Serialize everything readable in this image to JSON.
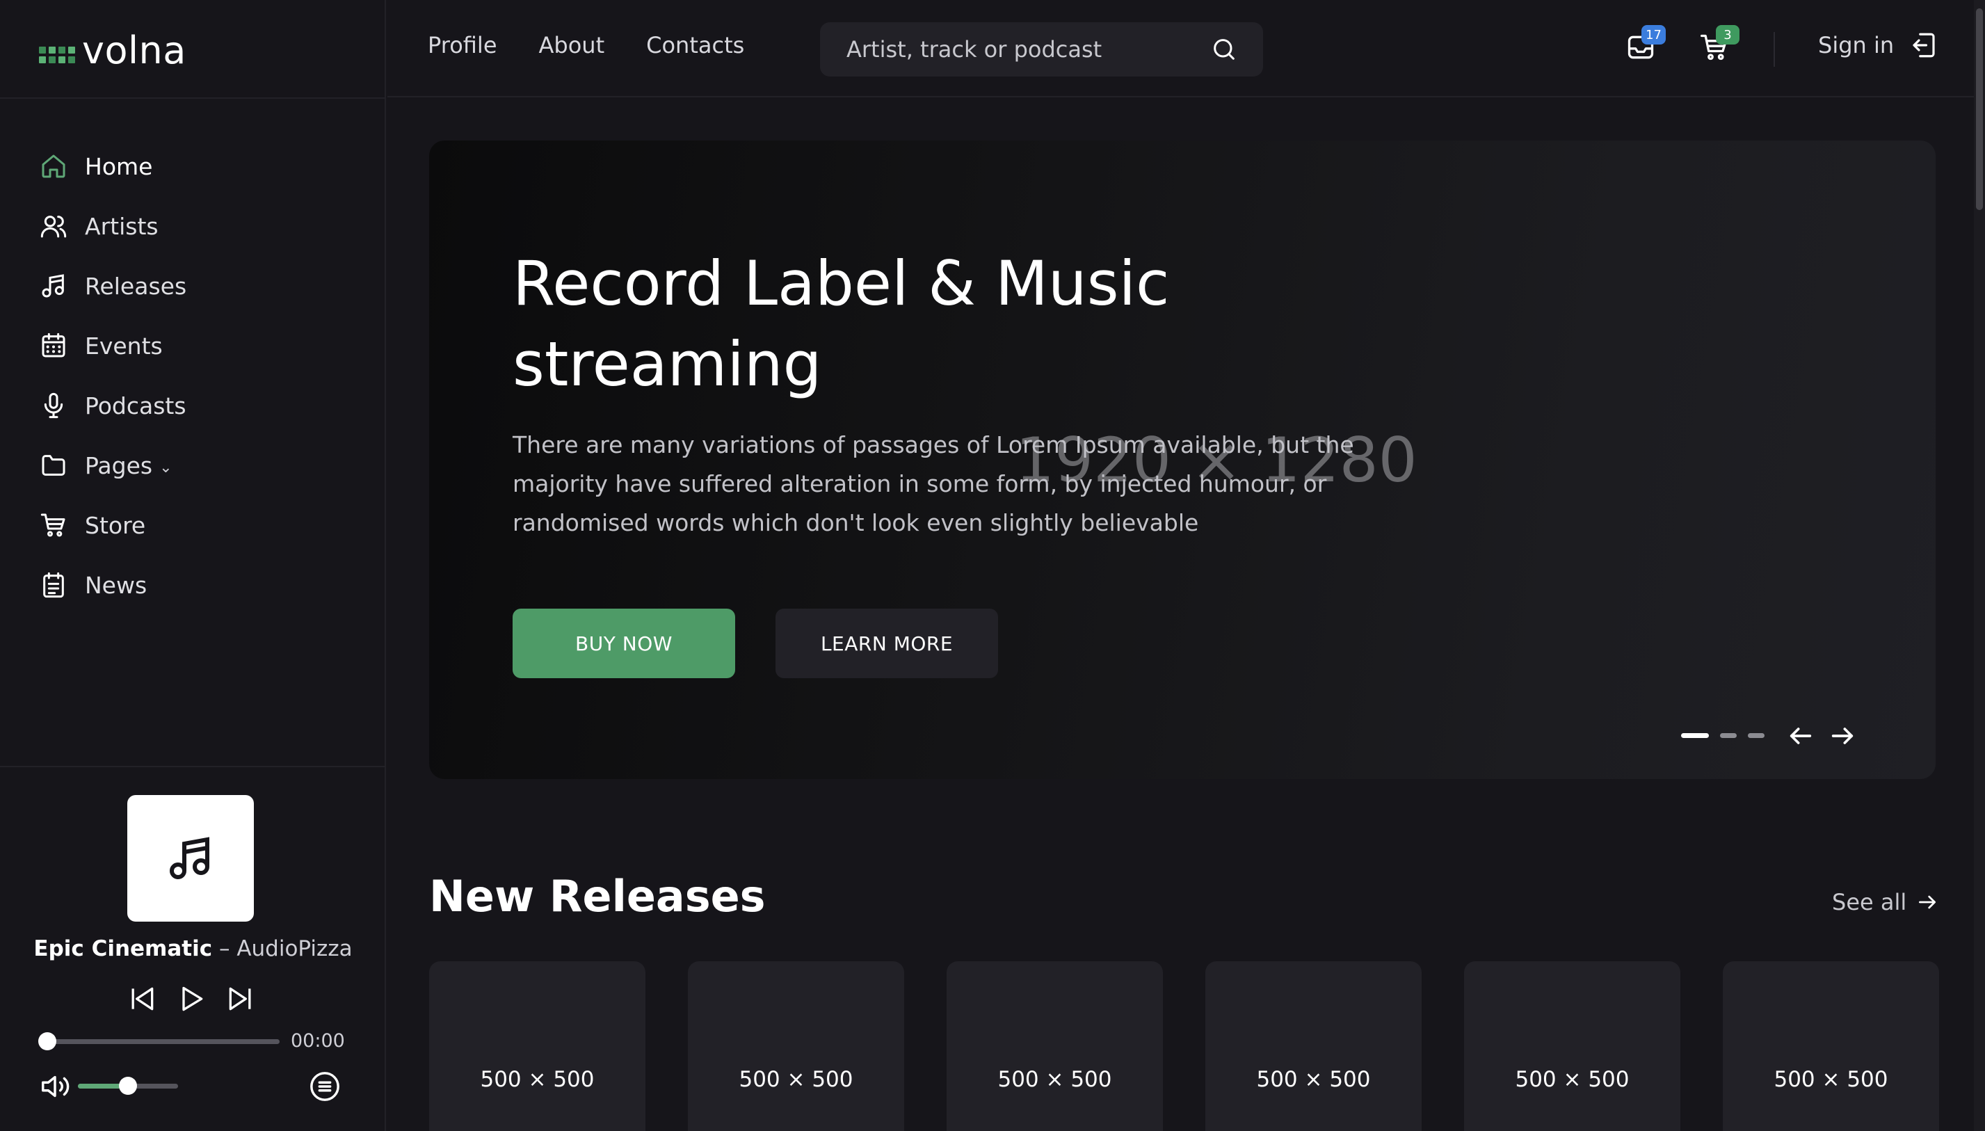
{
  "app": {
    "logo_text": "volna",
    "accent_color": "#5fa877"
  },
  "sidebar": {
    "items": [
      {
        "label": "Home",
        "icon": "home-icon",
        "active": true
      },
      {
        "label": "Artists",
        "icon": "users-icon"
      },
      {
        "label": "Releases",
        "icon": "music-note-icon"
      },
      {
        "label": "Events",
        "icon": "calendar-icon"
      },
      {
        "label": "Podcasts",
        "icon": "microphone-icon"
      },
      {
        "label": "Pages",
        "icon": "folder-icon",
        "has_dropdown": true
      },
      {
        "label": "Store",
        "icon": "cart-icon"
      },
      {
        "label": "News",
        "icon": "news-icon"
      }
    ]
  },
  "player": {
    "cover_icon": "music-note-icon",
    "track_title": "Epic Cinematic",
    "separator": " – ",
    "artist": "AudioPizza",
    "time": "00:00",
    "progress": 0.0,
    "volume": 0.5
  },
  "header": {
    "nav": [
      "Profile",
      "About",
      "Contacts"
    ],
    "search": {
      "placeholder": "Artist, track or podcast",
      "value": ""
    },
    "inbox_badge": "17",
    "inbox_badge_color": "#3b7ddd",
    "cart_badge": "3",
    "cart_badge_color": "#3f9a5f",
    "signin_label": "Sign in"
  },
  "hero": {
    "image_placeholder": "1920 × 1280",
    "title": "Record Label & Music streaming",
    "text": "There are many variations of passages of Lorem Ipsum available, but the majority have suffered alteration in some form, by injected humour, or randomised words which don't look even slightly believable",
    "buy_label": "BUY NOW",
    "learn_label": "LEARN MORE",
    "slides_count": 3,
    "active_slide": 1
  },
  "releases": {
    "title": "New Releases",
    "see_all": "See all",
    "cards": [
      {
        "label": "500 × 500"
      },
      {
        "label": "500 × 500"
      },
      {
        "label": "500 × 500"
      },
      {
        "label": "500 × 500"
      },
      {
        "label": "500 × 500"
      },
      {
        "label": "500 × 500"
      }
    ]
  }
}
